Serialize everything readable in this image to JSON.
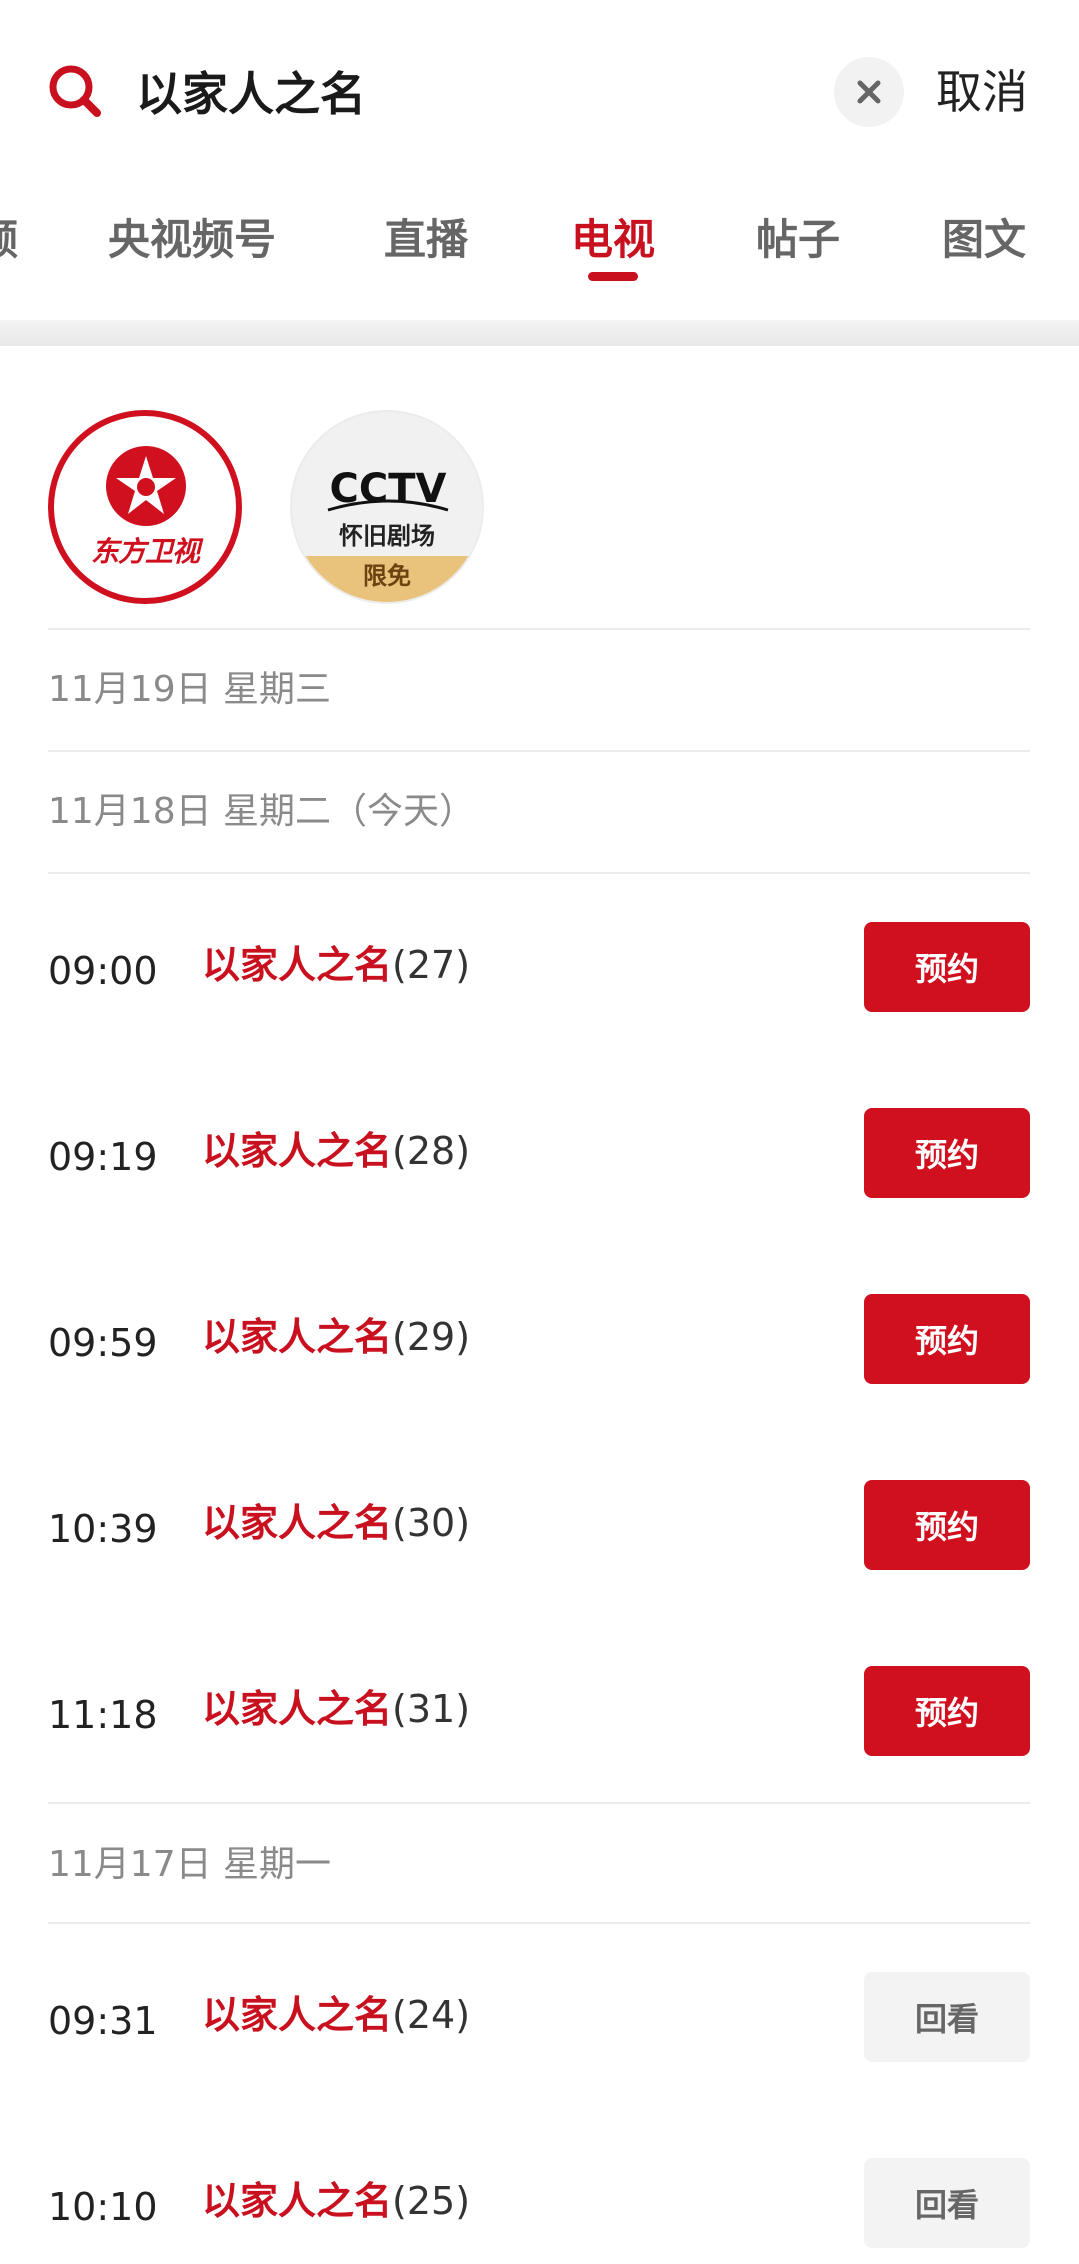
{
  "search": {
    "query": "以家人之名",
    "cancel_label": "取消"
  },
  "tabs": [
    {
      "label": "频"
    },
    {
      "label": "央视频号"
    },
    {
      "label": "直播"
    },
    {
      "label": "电视"
    },
    {
      "label": "帖子"
    },
    {
      "label": "图文"
    }
  ],
  "active_tab": "电视",
  "channels": {
    "dongfang": {
      "text": "东方卫视"
    },
    "cctv": {
      "logo_text": "CCTV",
      "subtitle": "怀旧剧场",
      "badge": "限免"
    }
  },
  "schedule": {
    "day1": {
      "label": "11月19日 星期三"
    },
    "day2": {
      "label": "11月18日 星期二（今天）",
      "items": [
        {
          "time": "09:00",
          "title": "以家人之名",
          "episode": "(27)",
          "action": "预约"
        },
        {
          "time": "09:19",
          "title": "以家人之名",
          "episode": "(28)",
          "action": "预约"
        },
        {
          "time": "09:59",
          "title": "以家人之名",
          "episode": "(29)",
          "action": "预约"
        },
        {
          "time": "10:39",
          "title": "以家人之名",
          "episode": "(30)",
          "action": "预约"
        },
        {
          "time": "11:18",
          "title": "以家人之名",
          "episode": "(31)",
          "action": "预约"
        }
      ]
    },
    "day3": {
      "label": "11月17日 星期一",
      "items": [
        {
          "time": "09:31",
          "title": "以家人之名",
          "episode": "(24)",
          "action": "回看"
        },
        {
          "time": "10:10",
          "title": "以家人之名",
          "episode": "(25)",
          "action": "回看"
        }
      ]
    }
  },
  "colors": {
    "accent": "#c8101e",
    "reserve_bg": "#d0101f",
    "replay_bg": "#f3f3f3"
  }
}
